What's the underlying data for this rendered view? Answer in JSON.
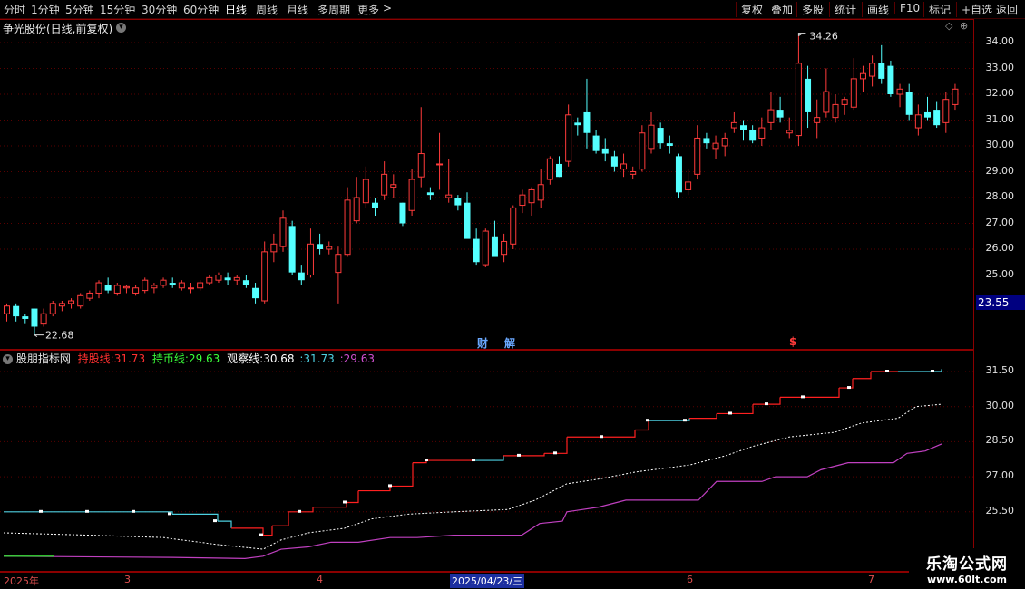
{
  "toolbar": {
    "periods": [
      "分时",
      "1分钟",
      "5分钟",
      "15分钟",
      "30分钟",
      "60分钟",
      "日线",
      "周线",
      "月线",
      "多周期",
      "更多"
    ],
    "active_period": "日线",
    "more_arrow": ">",
    "right_buttons": [
      "复权",
      "叠加",
      "多股",
      "统计",
      "画线",
      "F10",
      "标记",
      "+自选",
      "返回"
    ]
  },
  "main_chart": {
    "title": "争光股份(日线,前复权)",
    "high_label": "34.26",
    "low_label": "22.68",
    "current_price": "23.55",
    "event_markers": [
      "财",
      "解",
      "$"
    ],
    "y_ticks": [
      "34.00",
      "33.00",
      "32.00",
      "31.00",
      "30.00",
      "29.00",
      "28.00",
      "27.00",
      "26.00",
      "25.00"
    ]
  },
  "indicator": {
    "name": "股朋指标网",
    "line1_label": "持股线:",
    "line1_value": "31.73",
    "line2_label": "持币线:",
    "line2_value": "29.63",
    "line3_label": "观察线:",
    "line3_value": "30.68",
    "line4_value": ":31.73",
    "line5_value": ":29.63",
    "y_ticks": [
      "31.50",
      "30.00",
      "28.50",
      "27.00",
      "25.50"
    ]
  },
  "date_axis": {
    "labels": [
      "2025年",
      "3",
      "4",
      "2025/04/23/三",
      "6",
      "7"
    ]
  },
  "watermark": {
    "line1": "乐淘公式网",
    "line2": "www.60lt.com"
  },
  "colors": {
    "up": "#ff3b3b",
    "down": "#54ffff",
    "hold": "#ff2020",
    "cash": "#4dd0e1",
    "watch": "#ffffff",
    "base": "#c040c0",
    "frame": "#8b0000"
  },
  "chart_data": {
    "type": "candlestick",
    "candles": [
      [
        23.5,
        23.9,
        23.2,
        23.8
      ],
      [
        23.8,
        23.9,
        23.2,
        23.4
      ],
      [
        23.4,
        23.5,
        23.1,
        23.3
      ],
      [
        23.7,
        23.7,
        22.68,
        23.0
      ],
      [
        23.1,
        23.7,
        23.0,
        23.5
      ],
      [
        23.5,
        24.0,
        23.4,
        23.9
      ],
      [
        23.8,
        24.0,
        23.6,
        23.9
      ],
      [
        23.9,
        24.1,
        23.7,
        24.0
      ],
      [
        23.8,
        24.3,
        23.7,
        24.2
      ],
      [
        24.1,
        24.4,
        24.0,
        24.3
      ],
      [
        24.3,
        24.8,
        24.1,
        24.7
      ],
      [
        24.6,
        24.9,
        24.3,
        24.4
      ],
      [
        24.3,
        24.7,
        24.2,
        24.6
      ],
      [
        24.5,
        24.6,
        24.3,
        24.55
      ],
      [
        24.3,
        24.6,
        24.2,
        24.5
      ],
      [
        24.4,
        24.9,
        24.3,
        24.8
      ],
      [
        24.5,
        24.7,
        24.3,
        24.6
      ],
      [
        24.6,
        24.9,
        24.5,
        24.8
      ],
      [
        24.7,
        24.9,
        24.5,
        24.6
      ],
      [
        24.5,
        24.8,
        24.4,
        24.7
      ],
      [
        24.5,
        24.7,
        24.3,
        24.5
      ],
      [
        24.5,
        24.8,
        24.4,
        24.7
      ],
      [
        24.7,
        25.0,
        24.6,
        24.9
      ],
      [
        24.8,
        25.1,
        24.7,
        25.0
      ],
      [
        24.9,
        25.1,
        24.6,
        24.8
      ],
      [
        24.8,
        25.0,
        24.6,
        24.9
      ],
      [
        24.8,
        25.0,
        24.5,
        24.6
      ],
      [
        24.5,
        24.7,
        23.9,
        24.1
      ],
      [
        24.0,
        26.3,
        23.9,
        25.9
      ],
      [
        25.9,
        26.6,
        25.5,
        26.2
      ],
      [
        26.1,
        27.5,
        25.9,
        27.2
      ],
      [
        26.9,
        27.1,
        25.0,
        25.1
      ],
      [
        25.1,
        25.4,
        24.6,
        24.8
      ],
      [
        25.0,
        26.8,
        24.9,
        26.2
      ],
      [
        26.2,
        26.6,
        25.8,
        26.0
      ],
      [
        26.0,
        26.3,
        25.8,
        26.1
      ],
      [
        25.1,
        26.1,
        23.9,
        25.8
      ],
      [
        25.8,
        28.4,
        25.7,
        27.9
      ],
      [
        27.1,
        28.8,
        27.0,
        28.0
      ],
      [
        27.8,
        29.2,
        27.6,
        28.7
      ],
      [
        27.8,
        28.0,
        27.3,
        27.6
      ],
      [
        28.1,
        29.4,
        27.9,
        28.9
      ],
      [
        28.4,
        28.9,
        28.0,
        28.5
      ],
      [
        27.8,
        27.8,
        26.9,
        27.0
      ],
      [
        27.5,
        29.1,
        27.3,
        28.7
      ],
      [
        28.8,
        31.5,
        28.4,
        29.7
      ],
      [
        28.2,
        28.4,
        27.9,
        28.1
      ],
      [
        29.3,
        30.5,
        28.3,
        29.3
      ],
      [
        28.0,
        29.5,
        27.8,
        28.1
      ],
      [
        28.0,
        28.1,
        27.5,
        27.7
      ],
      [
        27.8,
        28.2,
        27.6,
        26.4
      ],
      [
        26.4,
        26.8,
        25.4,
        25.5
      ],
      [
        25.4,
        26.8,
        25.3,
        26.7
      ],
      [
        26.5,
        27.1,
        25.8,
        25.7
      ],
      [
        25.8,
        26.6,
        25.5,
        26.3
      ],
      [
        26.2,
        27.7,
        26.0,
        27.6
      ],
      [
        27.7,
        28.3,
        27.4,
        28.1
      ],
      [
        27.8,
        28.4,
        27.3,
        28.3
      ],
      [
        27.9,
        29.1,
        27.6,
        28.5
      ],
      [
        28.7,
        29.6,
        28.5,
        29.5
      ],
      [
        29.3,
        29.6,
        28.8,
        28.8
      ],
      [
        29.4,
        31.6,
        29.2,
        31.2
      ],
      [
        30.9,
        31.1,
        30.4,
        30.8
      ],
      [
        31.3,
        32.6,
        29.9,
        30.5
      ],
      [
        30.4,
        30.6,
        29.7,
        29.8
      ],
      [
        29.9,
        30.3,
        29.4,
        29.7
      ],
      [
        29.6,
        29.8,
        29.0,
        29.2
      ],
      [
        29.1,
        29.7,
        28.8,
        29.3
      ],
      [
        28.9,
        29.2,
        28.7,
        29.0
      ],
      [
        29.1,
        30.8,
        29.0,
        30.5
      ],
      [
        29.9,
        31.3,
        29.7,
        30.8
      ],
      [
        30.7,
        30.9,
        29.9,
        30.1
      ],
      [
        30.1,
        30.4,
        29.7,
        30.0
      ],
      [
        29.6,
        29.7,
        28.0,
        28.2
      ],
      [
        28.3,
        29.1,
        28.1,
        28.6
      ],
      [
        28.9,
        30.8,
        28.7,
        30.3
      ],
      [
        30.3,
        30.5,
        29.9,
        30.1
      ],
      [
        29.9,
        30.4,
        29.5,
        30.1
      ],
      [
        30.0,
        30.5,
        29.6,
        30.3
      ],
      [
        30.7,
        31.3,
        30.5,
        30.9
      ],
      [
        30.8,
        31.0,
        30.2,
        30.6
      ],
      [
        30.6,
        30.8,
        30.1,
        30.2
      ],
      [
        30.3,
        31.1,
        30.0,
        30.7
      ],
      [
        30.9,
        32.1,
        30.6,
        31.4
      ],
      [
        31.4,
        31.9,
        30.9,
        31.1
      ],
      [
        30.5,
        31.1,
        30.3,
        30.6
      ],
      [
        30.4,
        34.26,
        30.0,
        33.2
      ],
      [
        32.6,
        33.1,
        30.7,
        31.3
      ],
      [
        30.9,
        31.8,
        30.3,
        31.1
      ],
      [
        31.3,
        33.0,
        31.1,
        32.1
      ],
      [
        31.1,
        32.0,
        30.9,
        31.6
      ],
      [
        31.6,
        31.9,
        31.2,
        31.8
      ],
      [
        31.5,
        33.4,
        31.4,
        32.6
      ],
      [
        32.6,
        33.1,
        32.1,
        32.8
      ],
      [
        32.7,
        33.5,
        32.3,
        33.2
      ],
      [
        33.2,
        33.9,
        32.4,
        32.6
      ],
      [
        33.1,
        33.3,
        31.9,
        32.0
      ],
      [
        32.0,
        32.4,
        31.5,
        32.2
      ],
      [
        32.1,
        32.4,
        31.0,
        31.2
      ],
      [
        30.7,
        31.6,
        30.4,
        31.2
      ],
      [
        31.3,
        31.9,
        31.0,
        31.1
      ],
      [
        31.4,
        31.7,
        30.7,
        30.8
      ],
      [
        30.9,
        32.1,
        30.5,
        31.8
      ],
      [
        31.6,
        32.4,
        31.4,
        32.2
      ]
    ],
    "indicator_series": [
      {
        "label": "持股线",
        "value": 31.73
      },
      {
        "label": "持币线",
        "value": 29.63
      },
      {
        "label": "观察线",
        "value": 30.68
      }
    ]
  }
}
